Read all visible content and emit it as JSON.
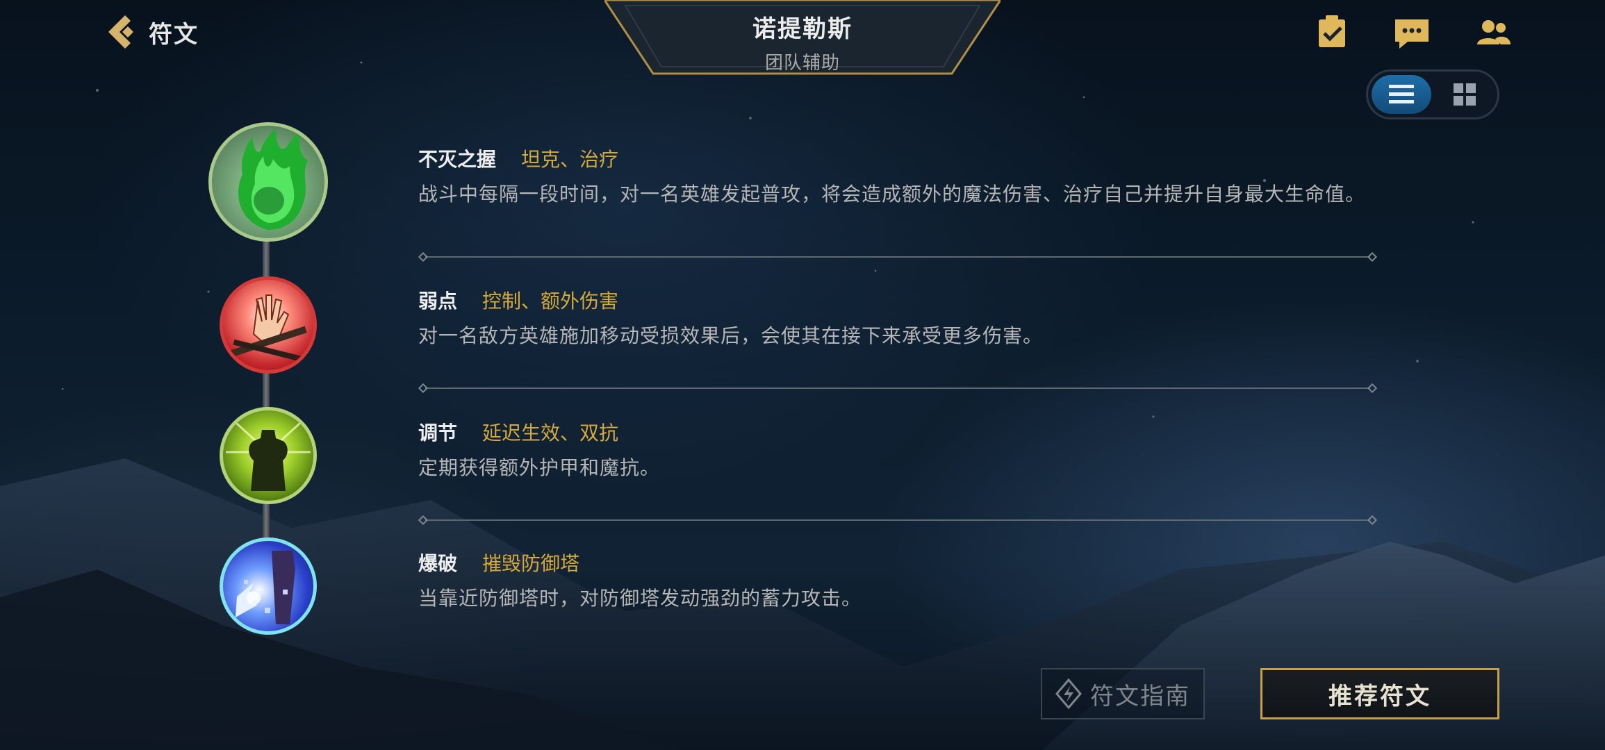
{
  "header": {
    "back_label": "符文",
    "champion_name": "诺提勒斯",
    "champion_role": "团队辅助"
  },
  "top_icons": [
    "clipboard-check-icon",
    "chat-icon",
    "friends-icon"
  ],
  "view_toggle": {
    "active": "list",
    "options": [
      "list",
      "grid"
    ]
  },
  "runes": [
    {
      "name": "不灭之握",
      "tags": "坦克、治疗",
      "description": "战斗中每隔一段时间，对一名英雄发起普攻，将会造成额外的魔法伤害、治疗自己并提升自身最大生命值。",
      "icon": "green-flame-hand-icon"
    },
    {
      "name": "弱点",
      "tags": "控制、额外伤害",
      "description": "对一名敌方英雄施加移动受损效果后，会使其在接下来承受更多伤害。",
      "icon": "bound-hand-icon"
    },
    {
      "name": "调节",
      "tags": "延迟生效、双抗",
      "description": "定期获得额外护甲和魔抗。",
      "icon": "armored-figure-icon"
    },
    {
      "name": "爆破",
      "tags": "摧毁防御塔",
      "description": "当靠近防御塔时，对防御塔发动强劲的蓄力攻击。",
      "icon": "tower-blast-icon"
    }
  ],
  "buttons": {
    "guide_label": "符文指南",
    "recommend_label": "推荐符文"
  },
  "colors": {
    "accent_gold": "#d6aa3a",
    "toggle_active": "#1e6ea8",
    "button_border": "#c7a048"
  }
}
